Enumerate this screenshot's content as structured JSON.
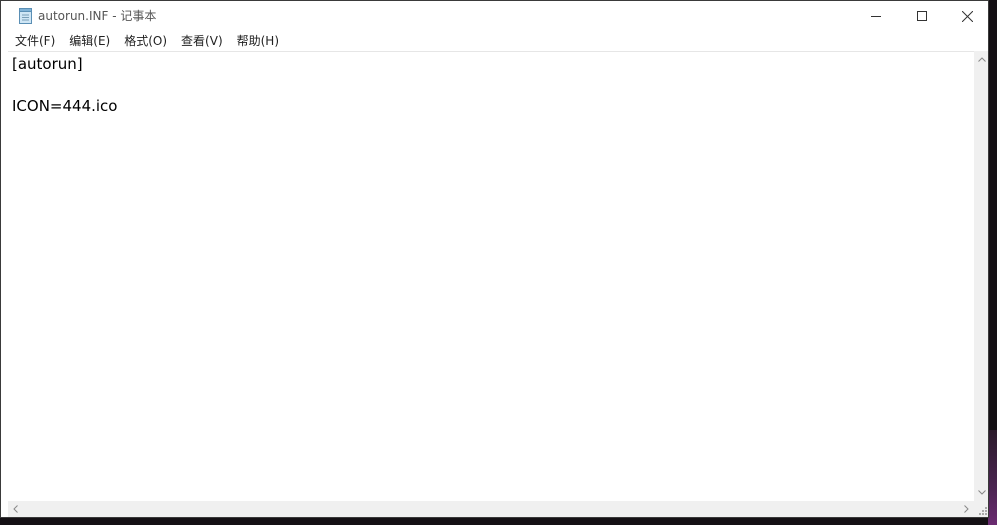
{
  "window": {
    "title": "autorun.INF - 记事本",
    "icon": "notepad-icon",
    "controls": [
      "minimize-icon",
      "maximize-icon",
      "close-icon"
    ]
  },
  "menu": [
    {
      "label": "文件(F)"
    },
    {
      "label": "编辑(E)"
    },
    {
      "label": "格式(O)"
    },
    {
      "label": "查看(V)"
    },
    {
      "label": "帮助(H)"
    }
  ],
  "editor": {
    "lines": [
      "[autorun]",
      "",
      "ICON=444.ico"
    ]
  },
  "colors": {
    "desktop": "#141014",
    "window_bg": "#ffffff",
    "scrollbar": "#f0f0f0"
  }
}
